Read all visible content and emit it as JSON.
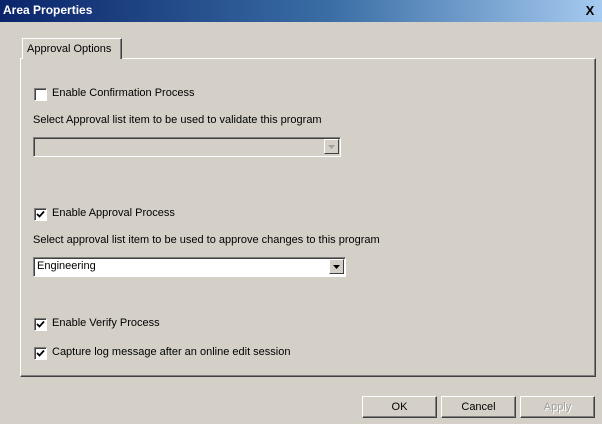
{
  "window": {
    "title": "Area Properties",
    "close_glyph": "X"
  },
  "tabs": [
    {
      "label": "Approval Options",
      "active": true
    }
  ],
  "confirmation": {
    "checkbox_label": "Enable Confirmation Process",
    "checked": false,
    "select_label": "Select Approval list item to be used to validate this program",
    "select_value": "",
    "select_enabled": false
  },
  "approval": {
    "checkbox_label": "Enable Approval Process",
    "checked": true,
    "select_label": "Select approval list item to be used to approve changes to this program",
    "select_value": "Engineering",
    "select_enabled": true
  },
  "verify": {
    "checkbox_label": "Enable Verify Process",
    "checked": true
  },
  "log_message": {
    "checkbox_label": "Capture log message after an online edit session",
    "checked": true
  },
  "buttons": {
    "ok_label": "OK",
    "cancel_label": "Cancel",
    "apply_label": "Apply",
    "apply_enabled": false
  },
  "colors": {
    "dialog_bg": "#d4d0c8",
    "title_bar_start": "#0a246a",
    "title_bar_end": "#a6caf0"
  }
}
